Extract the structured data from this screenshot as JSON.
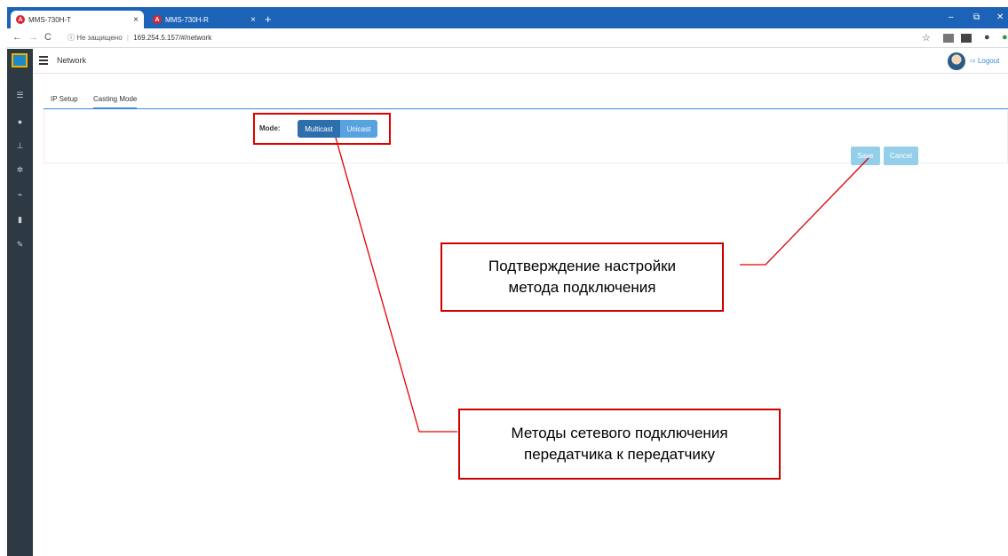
{
  "browser": {
    "tabs": [
      {
        "title": "MMS-730H-T",
        "active": true
      },
      {
        "title": "MMS-730H-R",
        "active": false
      }
    ],
    "new_tab": "+",
    "window_controls": {
      "minimize": "–",
      "restore": "⧉",
      "close": "✕"
    },
    "url_security": "ⓘ Не защищено",
    "url_separator": "|",
    "url": "169.254.5.157/#/network"
  },
  "app": {
    "title": "Network",
    "logout": "Logout",
    "sidebar_icons": [
      "list-icon",
      "user-icon",
      "network-icon",
      "gear-icon",
      "usb-icon",
      "storage-icon",
      "wrench-icon"
    ],
    "tabs": [
      {
        "label": "IP Setup",
        "active": false
      },
      {
        "label": "Casting Mode",
        "active": true
      }
    ],
    "mode": {
      "label": "Mode:",
      "options": [
        "Multicast",
        "Unicast"
      ],
      "selected": "Multicast"
    },
    "buttons": {
      "save": "Save",
      "cancel": "Cancel"
    }
  },
  "annotations": {
    "callout_save_line1": "Подтверждение настройки",
    "callout_save_line2": "метода подключения",
    "callout_mode_line1": "Методы сетевого подключения",
    "callout_mode_line2": "передатчика к передатчику"
  },
  "colors": {
    "accent": "#3b8ad9",
    "sidebar": "#2d3a43",
    "titlebar": "#1c63b7",
    "annotation": "#e00000"
  }
}
